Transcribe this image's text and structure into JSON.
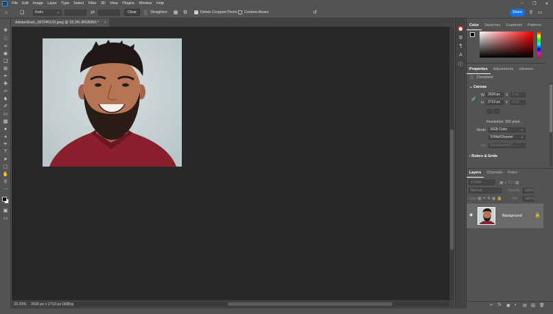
{
  "app": {
    "logo_text": "Ps"
  },
  "menu": [
    "File",
    "Edit",
    "Image",
    "Layer",
    "Type",
    "Select",
    "Filter",
    "3D",
    "View",
    "Plugins",
    "Window",
    "Help"
  ],
  "options_bar": {
    "ratio_label": "Ratio",
    "clear_label": "Clear",
    "straighten_label": "Straighten",
    "delete_cropped_label": "Delete Cropped Pixels",
    "delete_cropped_checked": true,
    "content_aware_label": "Content-Aware",
    "content_aware_checked": false,
    "share_label": "Share"
  },
  "document": {
    "tab_title": "AdobeStock_287245133.jpeg @ 33.3% (RGB/8#) *",
    "close_glyph": "×"
  },
  "status": {
    "zoom": "33.33%",
    "doc_info": "2926 px x 2713 px (300 ppi)",
    "arrow": ">"
  },
  "color_panel": {
    "tabs": [
      "Color",
      "Swatches",
      "Gradients",
      "Patterns"
    ],
    "active_tab": 0,
    "foreground": "#000000",
    "background": "#ffffff"
  },
  "properties_panel": {
    "tabs": [
      "Properties",
      "Adjustments",
      "Libraries"
    ],
    "active_tab": 0,
    "document_label": "Document",
    "canvas_section": "Canvas",
    "w_label": "W",
    "w_value": "2926 px",
    "h_label": "H",
    "h_value": "2713 px",
    "x_label": "X",
    "x_value": "0 px",
    "y_label": "Y",
    "y_value": "0 px",
    "resolution": "Resolution: 300 pixel...",
    "mode_label": "Mode",
    "mode_value": "RGB Color",
    "bits_value": "8 Bits/Channel",
    "fill_label": "Fill",
    "fill_value": "Background C...",
    "rulers_section": "Rulers & Grids"
  },
  "layers_panel": {
    "tabs": [
      "Layers",
      "Channels",
      "Paths"
    ],
    "active_tab": 0,
    "kind_placeholder": "Kind",
    "blend_mode": "Normal",
    "opacity_label": "Opacity:",
    "opacity_value": "100%",
    "lock_label": "Lock:",
    "fill_label": "Fill:",
    "fill_value": "100%",
    "layer_name": "Background"
  }
}
